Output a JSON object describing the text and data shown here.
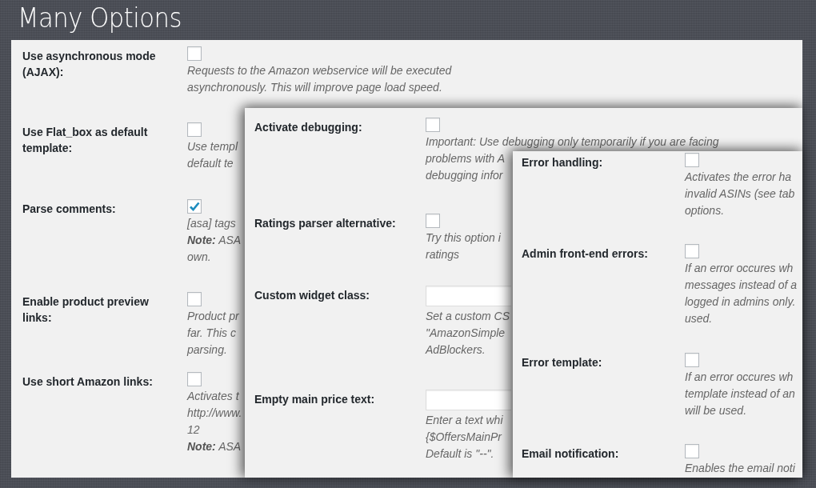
{
  "title": "Many Options",
  "panels": [
    {
      "rows": [
        {
          "label": "Use asynchronous mode (AJAX):",
          "kind": "checkbox",
          "checked": false,
          "description": [
            "Requests to the Amazon webservice will be executed",
            "asynchronously. This will improve page load speed."
          ]
        },
        {
          "label": "Use Flat_box as default template:",
          "kind": "checkbox",
          "checked": false,
          "description": [
            "Use templ",
            "default te"
          ]
        },
        {
          "label": "Parse comments:",
          "kind": "checkbox",
          "checked": true,
          "description": [
            "[asa] tags",
            "**Note:** ASA",
            "own."
          ]
        },
        {
          "label": "Enable product preview links:",
          "kind": "checkbox",
          "checked": false,
          "description": [
            "Product pr",
            "far. This c",
            "parsing."
          ]
        },
        {
          "label": "Use short Amazon links:",
          "kind": "checkbox",
          "checked": false,
          "description": [
            "Activates t",
            "http://www.",
            "12",
            "**Note:** ASA"
          ]
        }
      ]
    },
    {
      "rows": [
        {
          "label": "Activate debugging:",
          "kind": "checkbox",
          "checked": false,
          "description": [
            "Important: Use debugging only temporarily if you are facing",
            "problems with A",
            "debugging infor"
          ]
        },
        {
          "label": "Ratings parser alternative:",
          "kind": "checkbox",
          "checked": false,
          "description": [
            "Try this option i",
            "ratings"
          ]
        },
        {
          "label": "Custom widget class:",
          "kind": "text",
          "description": [
            "Set a custom CS",
            "\"AmazonSimple",
            "AdBlockers."
          ]
        },
        {
          "label": "Empty main price text:",
          "kind": "text",
          "description": [
            "Enter a text whi",
            "{$OffersMainPr",
            "Default is \"--\"."
          ]
        }
      ]
    },
    {
      "rows": [
        {
          "label": "Error handling:",
          "kind": "checkbox",
          "checked": false,
          "description": [
            "Activates the error ha",
            "invalid ASINs (see tab",
            "options."
          ]
        },
        {
          "label": "Admin front-end errors:",
          "kind": "checkbox",
          "checked": false,
          "description": [
            "If an error occures wh",
            "messages instead of a",
            "logged in admins only.",
            "used."
          ]
        },
        {
          "label": "Error template:",
          "kind": "checkbox",
          "checked": false,
          "description": [
            "If an error occures wh",
            "template instead of an",
            "will be used."
          ]
        },
        {
          "label": "Email notification:",
          "kind": "checkbox",
          "checked": false,
          "description": [
            "Enables the email noti"
          ]
        }
      ]
    }
  ]
}
